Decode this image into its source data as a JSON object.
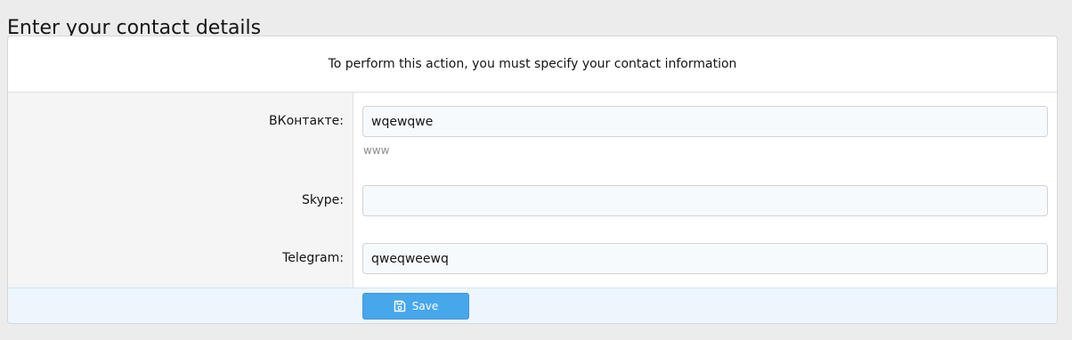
{
  "page": {
    "title": "Enter your contact details"
  },
  "block": {
    "header_text": "To perform this action, you must specify your contact information"
  },
  "fields": [
    {
      "label": "ВКонтакте:",
      "value": "wqewqwe",
      "placeholder": "",
      "hint": "www"
    },
    {
      "label": "Skype:",
      "value": "",
      "placeholder": ""
    },
    {
      "label": "Telegram:",
      "value": "qweqweewq",
      "placeholder": ""
    }
  ],
  "footer": {
    "save_label": "Save",
    "save_icon": "save-icon"
  },
  "colors": {
    "accent": "#47a7eb",
    "footer_bg": "#edf6fd",
    "label_col_bg": "#f5f5f5"
  }
}
